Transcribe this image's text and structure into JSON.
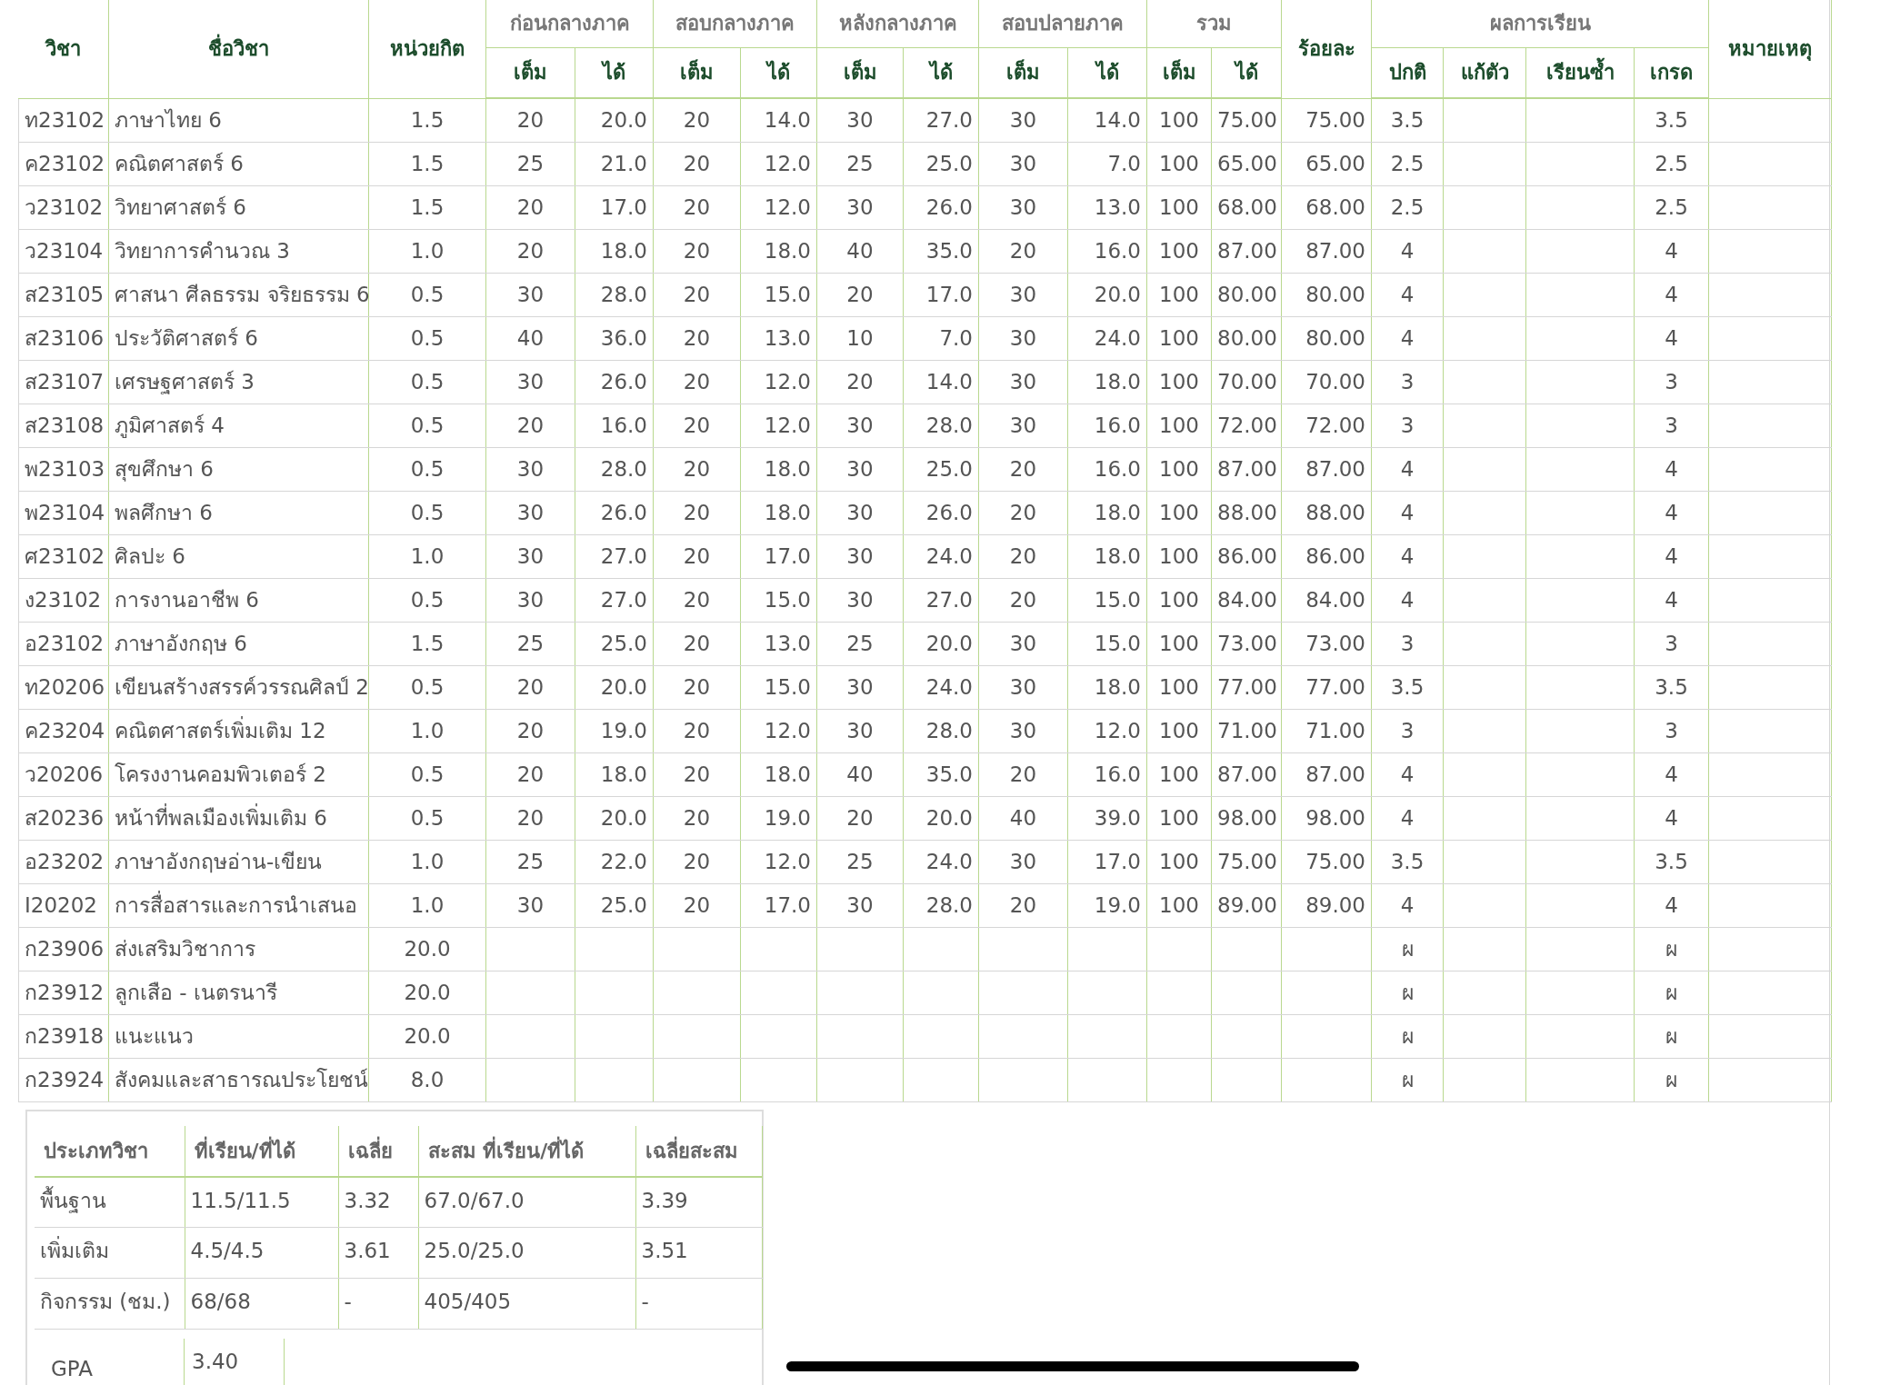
{
  "grades_table": {
    "columns": [
      {
        "label": "วิชา"
      },
      {
        "label": "ชื่อวิชา"
      },
      {
        "label": "หน่วยกิต"
      },
      {
        "label": "ก่อนกลางภาค",
        "sub": [
          "เต็ม",
          "ได้"
        ]
      },
      {
        "label": "สอบกลางภาค",
        "sub": [
          "เต็ม",
          "ได้"
        ]
      },
      {
        "label": "หลังกลางภาค",
        "sub": [
          "เต็ม",
          "ได้"
        ]
      },
      {
        "label": "สอบปลายภาค",
        "sub": [
          "เต็ม",
          "ได้"
        ]
      },
      {
        "label": "รวม",
        "sub": [
          "เต็ม",
          "ได้"
        ]
      },
      {
        "label": "ร้อยละ"
      },
      {
        "label": "ผลการเรียน",
        "sub": [
          "ปกติ",
          "แก้ตัว",
          "เรียนซ้ำ",
          "เกรด"
        ]
      },
      {
        "label": "หมายเหตุ"
      }
    ],
    "rows": [
      {
        "code": "ท23102",
        "name": "ภาษาไทย 6",
        "credit": "1.5",
        "scores": [
          "20",
          "20.0",
          "20",
          "14.0",
          "30",
          "27.0",
          "30",
          "14.0",
          "100",
          "75.00"
        ],
        "percent": "75.00",
        "grade_normal": "3.5",
        "grade": "3.5"
      },
      {
        "code": "ค23102",
        "name": "คณิตศาสตร์ 6",
        "credit": "1.5",
        "scores": [
          "25",
          "21.0",
          "20",
          "12.0",
          "25",
          "25.0",
          "30",
          "7.0",
          "100",
          "65.00"
        ],
        "percent": "65.00",
        "grade_normal": "2.5",
        "grade": "2.5"
      },
      {
        "code": "ว23102",
        "name": "วิทยาศาสตร์ 6",
        "credit": "1.5",
        "scores": [
          "20",
          "17.0",
          "20",
          "12.0",
          "30",
          "26.0",
          "30",
          "13.0",
          "100",
          "68.00"
        ],
        "percent": "68.00",
        "grade_normal": "2.5",
        "grade": "2.5"
      },
      {
        "code": "ว23104",
        "name": "วิทยาการคำนวณ 3",
        "credit": "1.0",
        "scores": [
          "20",
          "18.0",
          "20",
          "18.0",
          "40",
          "35.0",
          "20",
          "16.0",
          "100",
          "87.00"
        ],
        "percent": "87.00",
        "grade_normal": "4",
        "grade": "4"
      },
      {
        "code": "ส23105",
        "name": "ศาสนา ศีลธรรม จริยธรรม 6",
        "credit": "0.5",
        "scores": [
          "30",
          "28.0",
          "20",
          "15.0",
          "20",
          "17.0",
          "30",
          "20.0",
          "100",
          "80.00"
        ],
        "percent": "80.00",
        "grade_normal": "4",
        "grade": "4"
      },
      {
        "code": "ส23106",
        "name": "ประวัติศาสตร์ 6",
        "credit": "0.5",
        "scores": [
          "40",
          "36.0",
          "20",
          "13.0",
          "10",
          "7.0",
          "30",
          "24.0",
          "100",
          "80.00"
        ],
        "percent": "80.00",
        "grade_normal": "4",
        "grade": "4"
      },
      {
        "code": "ส23107",
        "name": "เศรษฐศาสตร์ 3",
        "credit": "0.5",
        "scores": [
          "30",
          "26.0",
          "20",
          "12.0",
          "20",
          "14.0",
          "30",
          "18.0",
          "100",
          "70.00"
        ],
        "percent": "70.00",
        "grade_normal": "3",
        "grade": "3"
      },
      {
        "code": "ส23108",
        "name": "ภูมิศาสตร์ 4",
        "credit": "0.5",
        "scores": [
          "20",
          "16.0",
          "20",
          "12.0",
          "30",
          "28.0",
          "30",
          "16.0",
          "100",
          "72.00"
        ],
        "percent": "72.00",
        "grade_normal": "3",
        "grade": "3"
      },
      {
        "code": "พ23103",
        "name": "สุขศึกษา 6",
        "credit": "0.5",
        "scores": [
          "30",
          "28.0",
          "20",
          "18.0",
          "30",
          "25.0",
          "20",
          "16.0",
          "100",
          "87.00"
        ],
        "percent": "87.00",
        "grade_normal": "4",
        "grade": "4"
      },
      {
        "code": "พ23104",
        "name": "พลศึกษา 6",
        "credit": "0.5",
        "scores": [
          "30",
          "26.0",
          "20",
          "18.0",
          "30",
          "26.0",
          "20",
          "18.0",
          "100",
          "88.00"
        ],
        "percent": "88.00",
        "grade_normal": "4",
        "grade": "4"
      },
      {
        "code": "ศ23102",
        "name": "ศิลปะ 6",
        "credit": "1.0",
        "scores": [
          "30",
          "27.0",
          "20",
          "17.0",
          "30",
          "24.0",
          "20",
          "18.0",
          "100",
          "86.00"
        ],
        "percent": "86.00",
        "grade_normal": "4",
        "grade": "4"
      },
      {
        "code": "ง23102",
        "name": "การงานอาชีพ 6",
        "credit": "0.5",
        "scores": [
          "30",
          "27.0",
          "20",
          "15.0",
          "30",
          "27.0",
          "20",
          "15.0",
          "100",
          "84.00"
        ],
        "percent": "84.00",
        "grade_normal": "4",
        "grade": "4"
      },
      {
        "code": "อ23102",
        "name": "ภาษาอังกฤษ 6",
        "credit": "1.5",
        "scores": [
          "25",
          "25.0",
          "20",
          "13.0",
          "25",
          "20.0",
          "30",
          "15.0",
          "100",
          "73.00"
        ],
        "percent": "73.00",
        "grade_normal": "3",
        "grade": "3"
      },
      {
        "code": "ท20206",
        "name": "เขียนสร้างสรรค์วรรณศิลป์ 2",
        "credit": "0.5",
        "scores": [
          "20",
          "20.0",
          "20",
          "15.0",
          "30",
          "24.0",
          "30",
          "18.0",
          "100",
          "77.00"
        ],
        "percent": "77.00",
        "grade_normal": "3.5",
        "grade": "3.5"
      },
      {
        "code": "ค23204",
        "name": "คณิตศาสตร์เพิ่มเติม 12",
        "credit": "1.0",
        "scores": [
          "20",
          "19.0",
          "20",
          "12.0",
          "30",
          "28.0",
          "30",
          "12.0",
          "100",
          "71.00"
        ],
        "percent": "71.00",
        "grade_normal": "3",
        "grade": "3"
      },
      {
        "code": "ว20206",
        "name": "โครงงานคอมพิวเตอร์ 2",
        "credit": "0.5",
        "scores": [
          "20",
          "18.0",
          "20",
          "18.0",
          "40",
          "35.0",
          "20",
          "16.0",
          "100",
          "87.00"
        ],
        "percent": "87.00",
        "grade_normal": "4",
        "grade": "4"
      },
      {
        "code": "ส20236",
        "name": "หน้าที่พลเมืองเพิ่มเติม 6",
        "credit": "0.5",
        "scores": [
          "20",
          "20.0",
          "20",
          "19.0",
          "20",
          "20.0",
          "40",
          "39.0",
          "100",
          "98.00"
        ],
        "percent": "98.00",
        "grade_normal": "4",
        "grade": "4"
      },
      {
        "code": "อ23202",
        "name": "ภาษาอังกฤษอ่าน-เขียน",
        "credit": "1.0",
        "scores": [
          "25",
          "22.0",
          "20",
          "12.0",
          "25",
          "24.0",
          "30",
          "17.0",
          "100",
          "75.00"
        ],
        "percent": "75.00",
        "grade_normal": "3.5",
        "grade": "3.5"
      },
      {
        "code": "I20202",
        "name": "การสื่อสารและการนำเสนอ",
        "credit": "1.0",
        "scores": [
          "30",
          "25.0",
          "20",
          "17.0",
          "30",
          "28.0",
          "20",
          "19.0",
          "100",
          "89.00"
        ],
        "percent": "89.00",
        "grade_normal": "4",
        "grade": "4"
      },
      {
        "code": "ก23906",
        "name": "ส่งเสริมวิชาการ",
        "credit": "20.0",
        "grade_normal": "ผ",
        "grade": "ผ"
      },
      {
        "code": "ก23912",
        "name": "ลูกเสือ - เนตรนารี",
        "credit": "20.0",
        "grade_normal": "ผ",
        "grade": "ผ"
      },
      {
        "code": "ก23918",
        "name": "แนะแนว",
        "credit": "20.0",
        "grade_normal": "ผ",
        "grade": "ผ"
      },
      {
        "code": "ก23924",
        "name": "สังคมและสาธารณประโยชน์",
        "credit": "8.0",
        "grade_normal": "ผ",
        "grade": "ผ"
      }
    ]
  },
  "summary_table": {
    "columns": [
      "ประเภทวิชา",
      "ที่เรียน/ที่ได้",
      "เฉลี่ย",
      "สะสม ที่เรียน/ที่ได้",
      "เฉลี่ยสะสม"
    ],
    "rows": [
      [
        "พื้นฐาน",
        "11.5/11.5",
        "3.32",
        "67.0/67.0",
        "3.39"
      ],
      [
        "เพิ่มเติม",
        "4.5/4.5",
        "3.61",
        "25.0/25.0",
        "3.51"
      ],
      [
        "กิจกรรม (ชม.)",
        "68/68",
        "-",
        "405/405",
        "-"
      ]
    ],
    "gpa": {
      "label": "GPA",
      "value": "3.40"
    }
  }
}
